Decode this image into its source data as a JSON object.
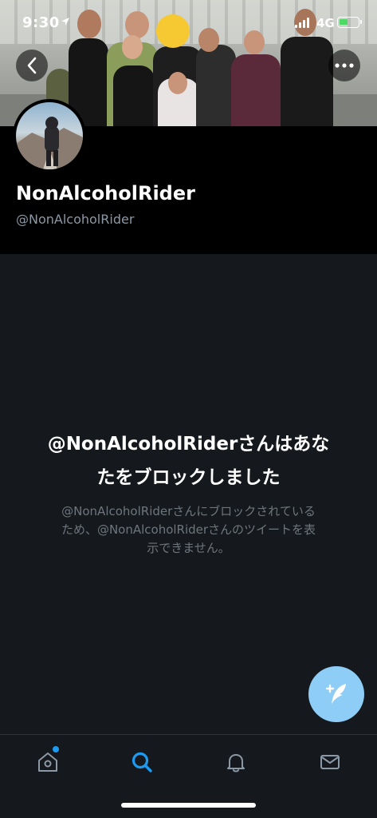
{
  "status_bar": {
    "time": "9:30",
    "network": "4G",
    "battery_level": 0.45
  },
  "profile": {
    "display_name": "NonAlcoholRider",
    "handle": "@NonAlcoholRider"
  },
  "blocked": {
    "title_line1": "@NonAlcoholRiderさんはあな",
    "title_line2": "たをブロックしました",
    "desc_line1": "@NonAlcoholRiderさんにブロックされている",
    "desc_line2": "ため、@NonAlcoholRiderさんのツイートを表",
    "desc_line3": "示できません。"
  },
  "tabs": [
    {
      "icon": "home-icon",
      "active": false,
      "badge": true
    },
    {
      "icon": "search-icon",
      "active": true,
      "badge": false
    },
    {
      "icon": "bell-icon",
      "active": false,
      "badge": false
    },
    {
      "icon": "mail-icon",
      "active": false,
      "badge": false
    }
  ],
  "colors": {
    "accent": "#1d9bf0",
    "fab": "#8ecdf6",
    "content_bg": "#15181c",
    "secondary_text": "#8b98a5"
  }
}
